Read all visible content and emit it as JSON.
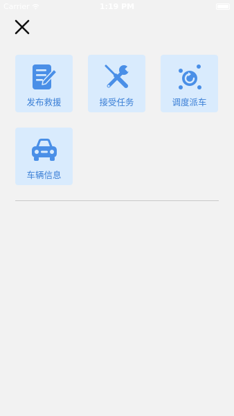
{
  "status_bar": {
    "carrier": "Carrier",
    "time": "1:19 PM"
  },
  "menu": {
    "items": [
      {
        "label": "发布救援",
        "icon": "edit-document-icon"
      },
      {
        "label": "接受任务",
        "icon": "tools-icon"
      },
      {
        "label": "调度派车",
        "icon": "dispatch-icon"
      },
      {
        "label": "车辆信息",
        "icon": "car-icon"
      }
    ]
  },
  "colors": {
    "background": "#f2f2f2",
    "tile_background": "#d9ebfd",
    "accent": "#3b7fd6",
    "icon": "#4a8fe7"
  }
}
